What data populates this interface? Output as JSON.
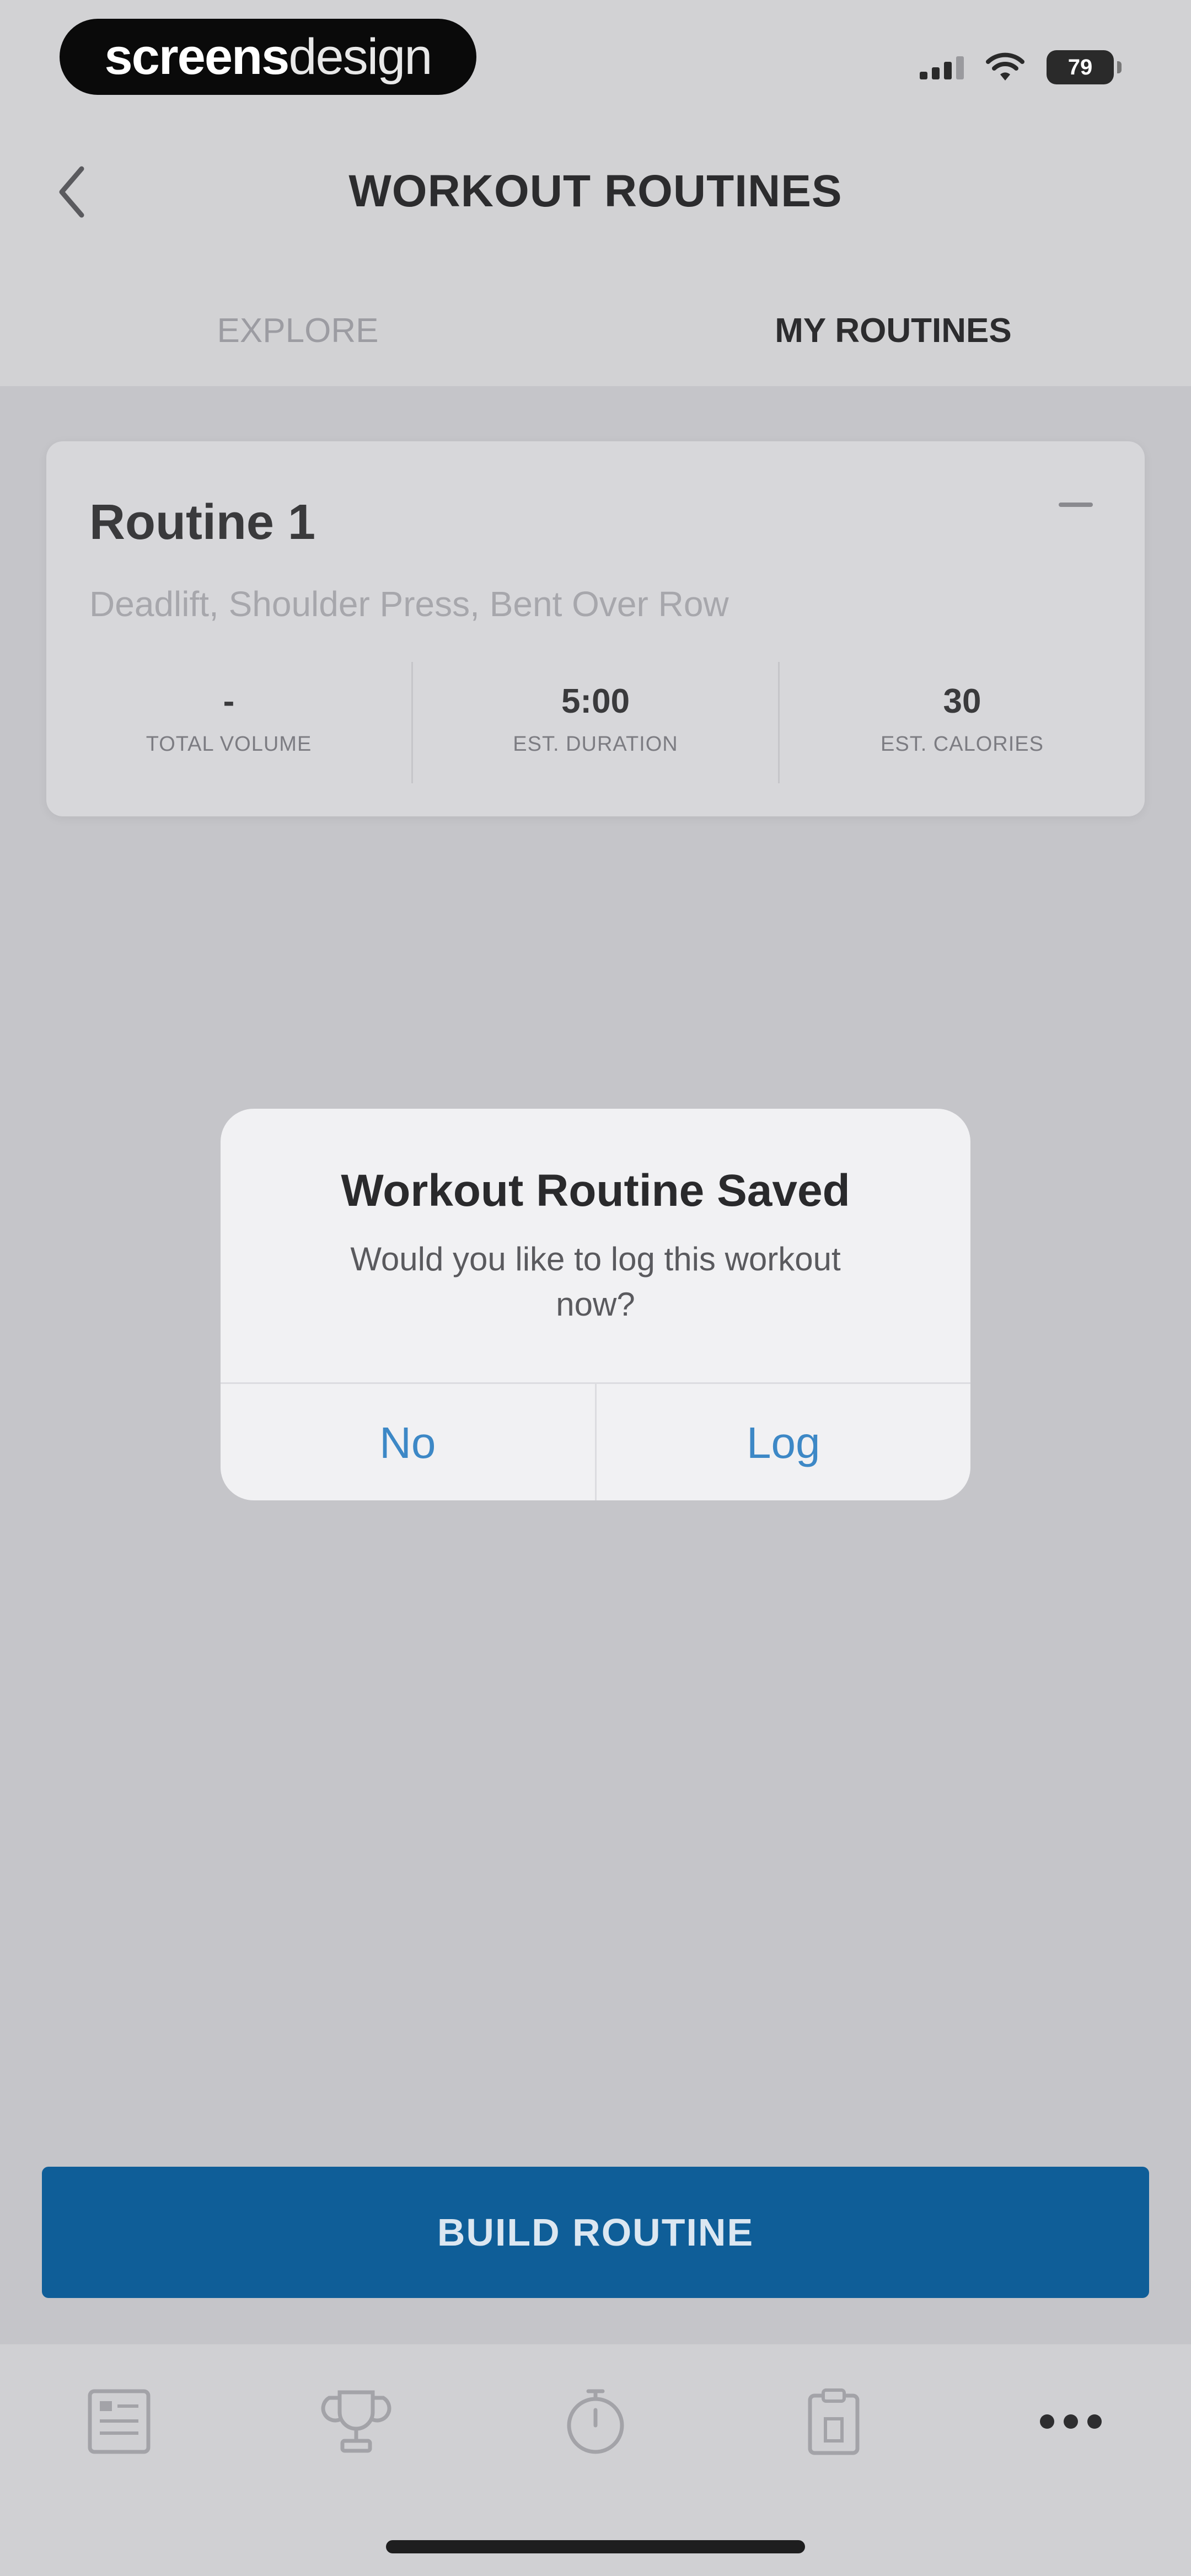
{
  "status_bar": {
    "brand_part1": "screens",
    "brand_part2": "design",
    "battery": "79"
  },
  "header": {
    "title": "WORKOUT ROUTINES",
    "tabs": [
      {
        "label": "EXPLORE",
        "active": false
      },
      {
        "label": "MY ROUTINES",
        "active": true
      }
    ]
  },
  "routine_card": {
    "title": "Routine 1",
    "exercises": "Deadlift, Shoulder Press, Bent Over Row",
    "stats": [
      {
        "value": "-",
        "label": "TOTAL VOLUME"
      },
      {
        "value": "5:00",
        "label": "EST. DURATION"
      },
      {
        "value": "30",
        "label": "EST. CALORIES"
      }
    ]
  },
  "dialog": {
    "title": "Workout Routine Saved",
    "message": "Would you like to log this workout now?",
    "buttons": {
      "no": "No",
      "log": "Log"
    }
  },
  "build_button": {
    "label": "BUILD ROUTINE"
  },
  "bottom_nav": [
    {
      "icon": "journal-icon"
    },
    {
      "icon": "trophy-icon"
    },
    {
      "icon": "stopwatch-icon"
    },
    {
      "icon": "clipboard-icon"
    },
    {
      "icon": "more-icon"
    }
  ],
  "colors": {
    "accent": "#0f5e98",
    "dialog_button": "#3d88c6"
  }
}
